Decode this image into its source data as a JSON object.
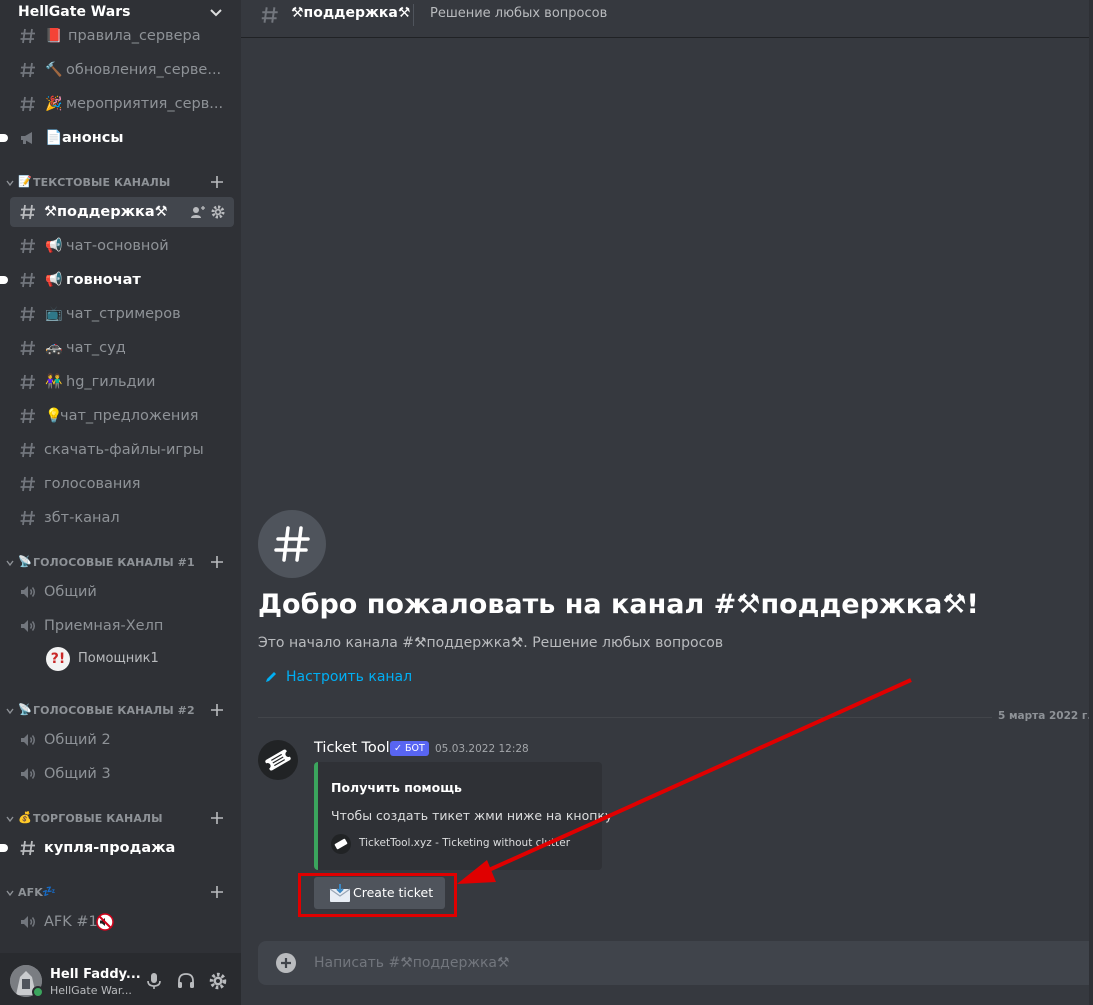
{
  "server": {
    "name": "HellGate Wars"
  },
  "channels": {
    "top": [
      {
        "emoji": "📕",
        "label": "правила_сервера"
      },
      {
        "emoji": "🔨",
        "label": "обновления_серве..."
      },
      {
        "emoji": "🎉",
        "label": "мероприятия_серв..."
      },
      {
        "emoji": "📄",
        "label": "анонсы"
      }
    ],
    "cat_text": {
      "emoji": "📝",
      "label": "ТЕКСТОВЫЕ КАНАЛЫ"
    },
    "text": [
      {
        "emoji": "⚒",
        "label": "поддержка⚒"
      },
      {
        "emoji": "📢",
        "label": "чат-основной"
      },
      {
        "emoji": "📢",
        "label": "говночат"
      },
      {
        "emoji": "📺",
        "label": "чат_стримеров"
      },
      {
        "emoji": "🚓",
        "label": "чат_суд"
      },
      {
        "emoji": "👫",
        "label": "hg_гильдии"
      },
      {
        "emoji": "💡",
        "label": "чат_предложения"
      },
      {
        "emoji": "",
        "label": "скачать-файлы-игры"
      },
      {
        "emoji": "",
        "label": "голосования"
      },
      {
        "emoji": "",
        "label": "збт-канал"
      }
    ],
    "cat_voice1": {
      "emoji": "📡",
      "label": "ГОЛОСОВЫЕ КАНАЛЫ #1"
    },
    "voice1": [
      {
        "label": "Общий"
      },
      {
        "label": "Приемная-Хелп"
      }
    ],
    "voice_user": {
      "avatar": "?!",
      "name": "Помощник1"
    },
    "cat_voice2": {
      "emoji": "📡",
      "label": "ГОЛОСОВЫЕ КАНАЛЫ #2"
    },
    "voice2": [
      {
        "label": "Общий 2"
      },
      {
        "label": "Общий 3"
      }
    ],
    "cat_trade": {
      "emoji": "💰",
      "label": "ТОРГОВЫЕ КАНАЛЫ"
    },
    "trade": [
      {
        "label": "купля-продажа"
      }
    ],
    "cat_afk": {
      "emoji": "💤",
      "label": "AFK"
    },
    "afk": [
      {
        "label": "AFK #1"
      }
    ]
  },
  "user": {
    "name": "Hell Faddy...",
    "tag": "HellGate War..."
  },
  "header": {
    "title": "⚒поддержка⚒",
    "topic": "Решение любых вопросов"
  },
  "welcome": {
    "title": "Добро пожаловать на канал #⚒поддержка⚒!",
    "subtitle": "Это начало канала #⚒поддержка⚒. Решение любых вопросов",
    "setup_link": "Настроить канал"
  },
  "date_divider": "5 марта 2022 г.",
  "message": {
    "author": "Ticket Tool",
    "bot_tag": "✓ БОТ",
    "timestamp": "05.03.2022 12:28",
    "embed": {
      "title": "Получить помощь",
      "description": "Чтобы создать тикет жми ниже на кнопку",
      "footer": "TicketTool.xyz - Ticketing without clutter"
    },
    "button_label": "Create ticket"
  },
  "composer": {
    "placeholder": "Написать #⚒поддержка⚒"
  },
  "colors": {
    "accent": "#5865f2",
    "link": "#00aff4",
    "embed_bar": "#3ba55d",
    "annotation": "#e00000",
    "online": "#3ba55d"
  },
  "icons": {
    "hash": "hash-icon",
    "speaker": "speaker-icon",
    "plus": "plus-icon",
    "gear": "gear-icon",
    "mic": "microphone-icon",
    "headphones": "headphones-icon"
  }
}
